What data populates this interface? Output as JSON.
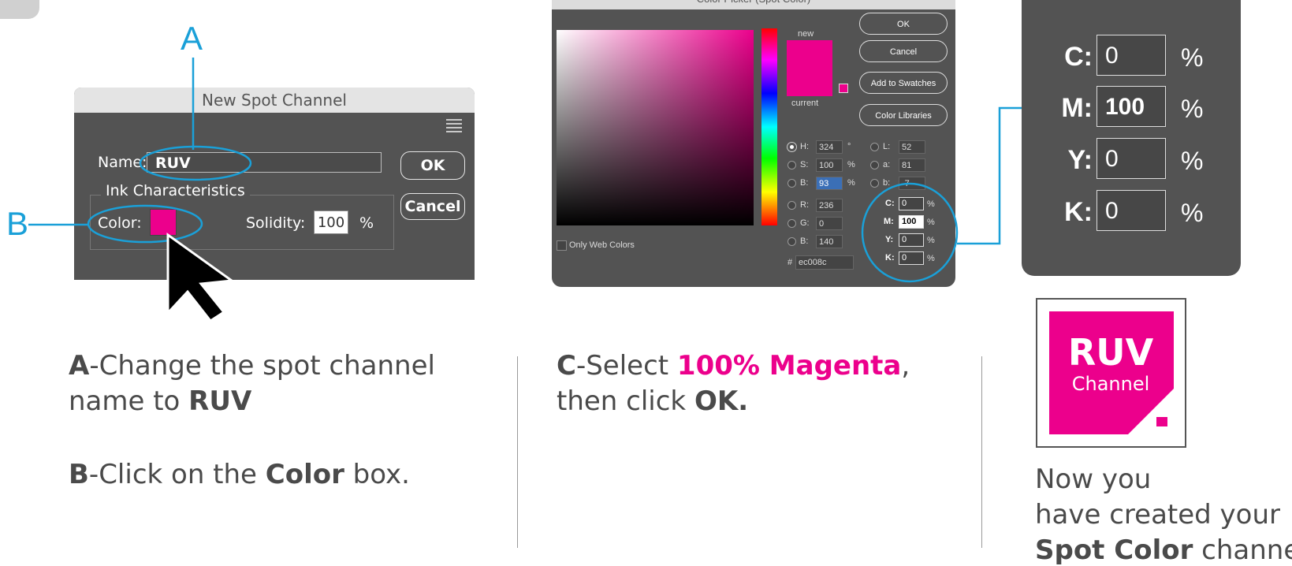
{
  "callouts": {
    "a": "A",
    "b": "B"
  },
  "spot_dialog": {
    "title": "New Spot Channel",
    "name_label": "Name:",
    "name_value": "RUV",
    "ok": "OK",
    "cancel": "Cancel",
    "group_label": "Ink Characteristics",
    "color_label": "Color:",
    "solidity_label": "Solidity:",
    "solidity_value": "100",
    "solidity_unit": "%",
    "swatch_color": "#ec008c"
  },
  "color_picker": {
    "title": "Color Picker (Spot Color)",
    "new_label": "new",
    "current_label": "current",
    "buttons": {
      "ok": "OK",
      "cancel": "Cancel",
      "add": "Add to Swatches",
      "libraries": "Color Libraries"
    },
    "only_web": "Only Web Colors",
    "hsb": [
      {
        "label": "H:",
        "value": "324",
        "unit": "°"
      },
      {
        "label": "S:",
        "value": "100",
        "unit": "%"
      },
      {
        "label": "B:",
        "value": "93",
        "unit": "%"
      }
    ],
    "rgb": [
      {
        "label": "R:",
        "value": "236"
      },
      {
        "label": "G:",
        "value": "0"
      },
      {
        "label": "B:",
        "value": "140"
      }
    ],
    "lab": [
      {
        "label": "L:",
        "value": "52"
      },
      {
        "label": "a:",
        "value": "81"
      },
      {
        "label": "b:",
        "value": "-7"
      }
    ],
    "cmyk": [
      {
        "label": "C:",
        "value": "0",
        "unit": "%"
      },
      {
        "label": "M:",
        "value": "100",
        "unit": "%"
      },
      {
        "label": "Y:",
        "value": "0",
        "unit": "%"
      },
      {
        "label": "K:",
        "value": "0",
        "unit": "%"
      }
    ],
    "hex_label": "#",
    "hex_value": "ec008c"
  },
  "zoom_cmyk": [
    {
      "label": "C:",
      "value": "0",
      "unit": "%"
    },
    {
      "label": "M:",
      "value": "100",
      "unit": "%"
    },
    {
      "label": "Y:",
      "value": "0",
      "unit": "%"
    },
    {
      "label": "K:",
      "value": "0",
      "unit": "%"
    }
  ],
  "captions": {
    "a_letter": "A",
    "a_text": "-Change the spot channel name to ",
    "a_bold": "RUV",
    "b_letter": "B",
    "b_text1": "-Click on the ",
    "b_bold": "Color",
    "b_text2": " box.",
    "c_letter": "C",
    "c_text1": "-Select ",
    "c_mag": "100% Magenta",
    "c_text2": ", then click ",
    "c_bold": "OK."
  },
  "logo": {
    "line1": "RUV",
    "line2": "Channel",
    "color": "#ec008c"
  },
  "final_text": {
    "line1": "Now you",
    "line2": "have created your",
    "bold": "Spot Color",
    "rest": " channel"
  }
}
